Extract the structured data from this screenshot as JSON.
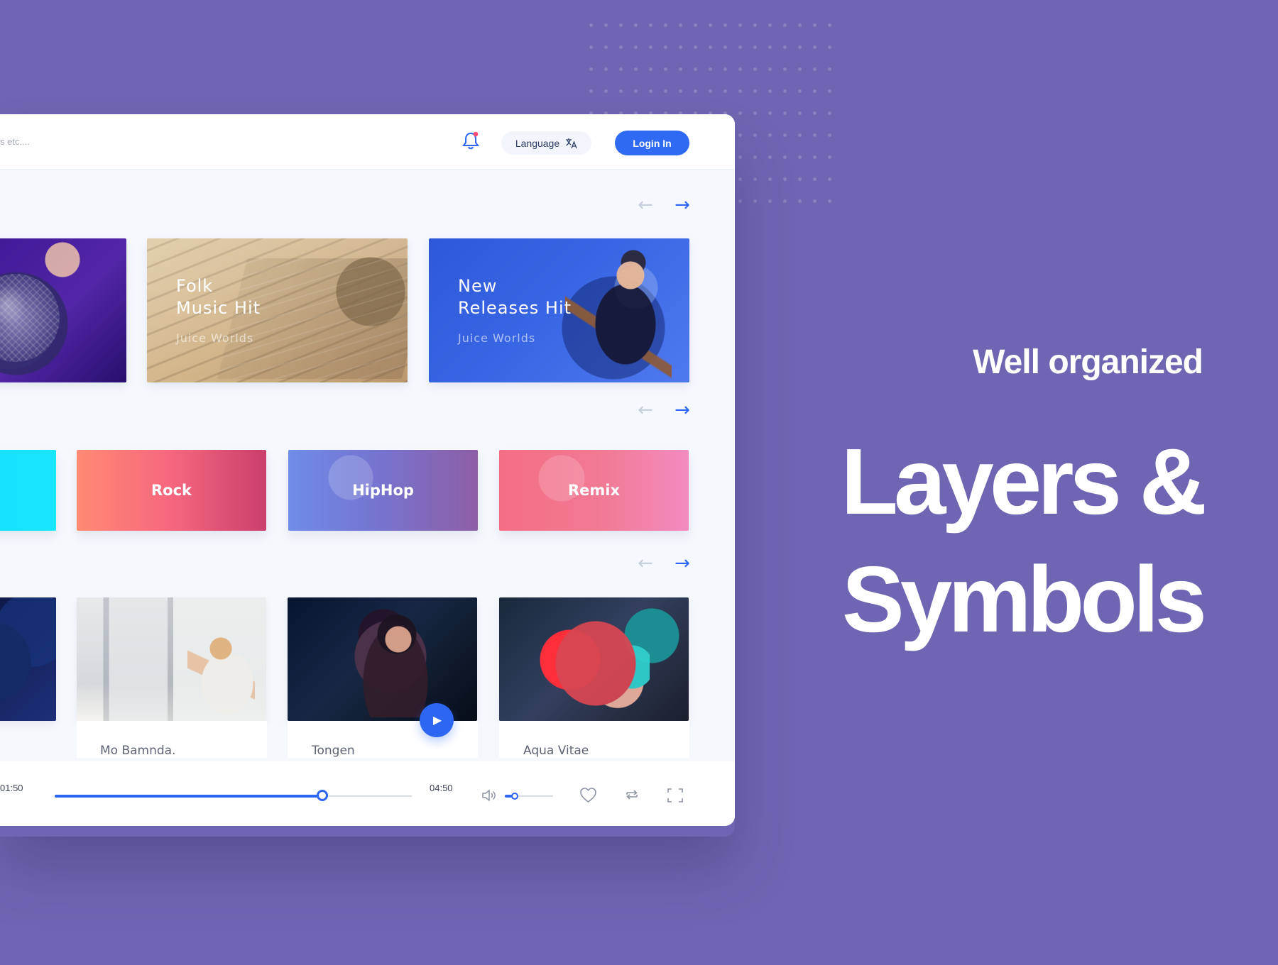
{
  "header": {
    "search_placeholder": "s etc....",
    "language_label": "Language",
    "login_label": "Login In",
    "icons": {
      "bell": "bell-icon",
      "language": "translate-icon"
    }
  },
  "carousel_nav": {
    "previous_glyph": "←",
    "next_glyph": "→"
  },
  "featured_playlists": [
    {
      "title": "",
      "subtitle": ""
    },
    {
      "title": "Folk\nMusic Hit",
      "subtitle": "Juice Worlds"
    },
    {
      "title": "New\nReleases Hit",
      "subtitle": "Juice Worlds"
    }
  ],
  "genres": [
    {
      "label": ""
    },
    {
      "label": "Rock"
    },
    {
      "label": "HipHop"
    },
    {
      "label": "Remix"
    }
  ],
  "artists": [
    {
      "name": ""
    },
    {
      "name": "Mo Bamnda."
    },
    {
      "name": "Tongen"
    },
    {
      "name": "Aqua Vitae"
    }
  ],
  "player": {
    "current_time": "01:50",
    "total_time": "04:50",
    "progress_fraction": 0.75,
    "volume_fraction": 0.21,
    "icons": {
      "play": "play-icon",
      "volume": "speaker-icon",
      "heart": "heart-icon",
      "repeat": "repeat-icon",
      "fullscreen": "fullscreen-icon"
    }
  },
  "promo": {
    "tagline": "Well organized",
    "headline": "Layers &\nSymbols"
  },
  "colors": {
    "page_background": "#6f66b3",
    "accent_blue": "#2d66f3",
    "login_blue": "#2f6af5"
  }
}
